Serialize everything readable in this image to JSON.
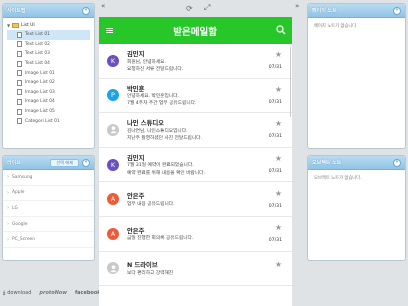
{
  "sitemap": {
    "title": "사이트맵",
    "root": "List UI",
    "items": [
      {
        "label": "Text List 01",
        "selected": true
      },
      {
        "label": "Text List 02"
      },
      {
        "label": "Text List 03"
      },
      {
        "label": "Text List 04"
      },
      {
        "label": "Image List 01"
      },
      {
        "label": "Image List 02"
      },
      {
        "label": "Image List 03"
      },
      {
        "label": "Image List 04"
      },
      {
        "label": "Image List 05"
      },
      {
        "label": "Categori List 01"
      }
    ]
  },
  "library": {
    "title": "라이브",
    "filter_label": "선택 해제",
    "items": [
      "Samsung",
      "Apple",
      "LG",
      "Google",
      "PC_Screen"
    ]
  },
  "footer": {
    "download": "download",
    "protonow": "protoNow",
    "facebook": "facebook"
  },
  "app": {
    "title": "받은메일함",
    "mails": [
      {
        "sender": "김민지",
        "lines": [
          "회원님, 안녕하세요.",
          "요청하신 서류 전달드립니다."
        ],
        "date": "07/31",
        "avatar": "K",
        "color": "#6a4fc2"
      },
      {
        "sender": "박민훈",
        "lines": [
          "안녕하세요. 박민훈입니다.",
          "7월 4주차 주간 업무 공유드립니다."
        ],
        "date": "07/31",
        "avatar": "P",
        "color": "#19a3e8"
      },
      {
        "sender": "나인 스튜디오",
        "lines": [
          "김나연님, 나인스튜디오입니다.",
          "지난주 촬영하셨던 사진 전달드립니다."
        ],
        "date": "07/31",
        "avatar": "",
        "color": "#c9c9c9"
      },
      {
        "sender": "김민지",
        "lines": [
          "7월 31일 예약이 완료되었습니다.",
          "예약 완료를 위해 내용을 확인 바랍니다."
        ],
        "date": "07/31",
        "avatar": "K",
        "color": "#6a4fc2"
      },
      {
        "sender": "안은주",
        "lines": [
          "업무 내용 공유드립니다."
        ],
        "date": "07/31",
        "avatar": "A",
        "color": "#ef5a3a"
      },
      {
        "sender": "안은주",
        "lines": [
          "금일 진행한 회의록 공유드립니다."
        ],
        "date": "07/31",
        "avatar": "A",
        "color": "#ef5a3a"
      },
      {
        "sender": "N 드라이브",
        "lines": [
          "보다 편리하고 강력해진"
        ],
        "date": "",
        "avatar": "",
        "color": "#c9c9c9"
      }
    ]
  },
  "pagenote": {
    "title": "페이지 노트",
    "text": "페이지 노트가 없습니다."
  },
  "objnote": {
    "title": "오브젝트 노트",
    "text": "오브젝트 노트가 없습니다."
  }
}
